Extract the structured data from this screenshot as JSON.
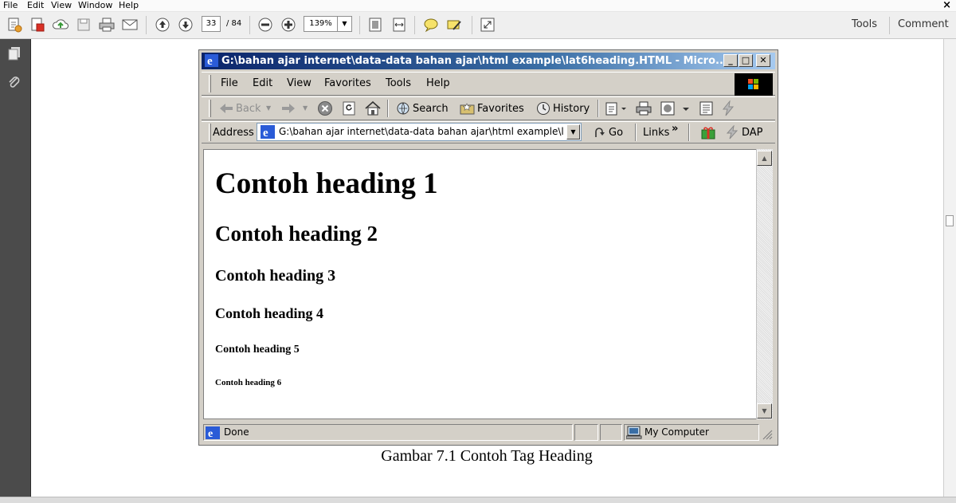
{
  "reader": {
    "menu": [
      "File",
      "Edit",
      "View",
      "Window",
      "Help"
    ],
    "close_glyph": "×",
    "current_page": "33",
    "page_total": "/ 84",
    "zoom": "139%",
    "tools_label": "Tools",
    "comment_label": "Comment"
  },
  "ie": {
    "title": "G:\\bahan ajar internet\\data-data bahan ajar\\html example\\lat6heading.HTML - Micro...",
    "minimize_glyph": "_",
    "maximize_glyph": "□",
    "close_glyph": "✕",
    "menu": [
      "File",
      "Edit",
      "View",
      "Favorites",
      "Tools",
      "Help"
    ],
    "toolbar": {
      "back": "Back",
      "search": "Search",
      "favorites": "Favorites",
      "history": "History"
    },
    "address_label": "Address",
    "address_value": "G:\\bahan ajar internet\\data-data bahan ajar\\html example\\l",
    "go_label": "Go",
    "links_label": "Links",
    "links_chevron": "»",
    "dap_label": "DAP",
    "status_text": "Done",
    "zone_text": "My Computer"
  },
  "content": {
    "h1": "Contoh heading 1",
    "h2": "Contoh heading 2",
    "h3": "Contoh heading 3",
    "h4": "Contoh heading 4",
    "h5": "Contoh heading 5",
    "h6": "Contoh heading 6"
  },
  "caption": "Gambar 7.1 Contoh Tag Heading",
  "colors": {
    "ie_title_start": "#0a246a",
    "ie_title_end": "#a6caf0",
    "classic_face": "#d4d0c8",
    "reader_nav": "#4b4b4b"
  },
  "icons": [
    "create-pdf-icon",
    "convert-icon",
    "upload-cloud-icon",
    "save-icon",
    "print-icon",
    "email-icon",
    "page-up-icon",
    "page-down-icon",
    "zoom-out-icon",
    "zoom-in-icon",
    "fit-page-icon",
    "fit-width-icon",
    "comment-bubble-icon",
    "highlight-icon",
    "full-screen-icon",
    "pages-panel-icon",
    "attachment-icon",
    "ie-logo-icon",
    "windows-logo-icon"
  ]
}
